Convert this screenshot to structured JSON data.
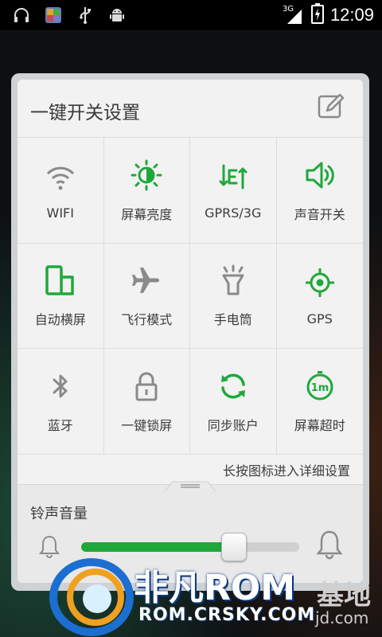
{
  "statusbar": {
    "network_type": "3G",
    "time": "12:09",
    "icons": [
      "headphones-icon",
      "app-notification-icon",
      "usb-icon",
      "android-debug-icon"
    ]
  },
  "panel": {
    "title": "一键开关设置",
    "edit_icon": "edit-icon",
    "tiles": [
      {
        "label": "WIFI",
        "icon": "wifi-icon",
        "active": false
      },
      {
        "label": "屏幕亮度",
        "icon": "brightness-icon",
        "active": true
      },
      {
        "label": "GPRS/3G",
        "icon": "data-transfer-icon",
        "active": true
      },
      {
        "label": "声音开关",
        "icon": "speaker-icon",
        "active": true
      },
      {
        "label": "自动横屏",
        "icon": "auto-rotate-icon",
        "active": true
      },
      {
        "label": "飞行模式",
        "icon": "airplane-icon",
        "active": false
      },
      {
        "label": "手电筒",
        "icon": "flashlight-icon",
        "active": false
      },
      {
        "label": "GPS",
        "icon": "gps-icon",
        "active": true
      },
      {
        "label": "蓝牙",
        "icon": "bluetooth-icon",
        "active": false
      },
      {
        "label": "一键锁屏",
        "icon": "lock-icon",
        "active": false
      },
      {
        "label": "同步账户",
        "icon": "sync-icon",
        "active": true
      },
      {
        "label": "屏幕超时",
        "icon": "screen-timeout-icon",
        "active": true,
        "text": "1m"
      }
    ],
    "hint": "长按图标进入详细设置"
  },
  "volume": {
    "label": "铃声音量",
    "level": 0.7
  },
  "watermark": {
    "brand": "非凡ROM",
    "domain": "ROM.CRSKY.COM",
    "suffix": "基地",
    "suffix_domain": "jd.com"
  },
  "colors": {
    "active": "#1fa83a",
    "inactive": "#8a8a8a"
  }
}
